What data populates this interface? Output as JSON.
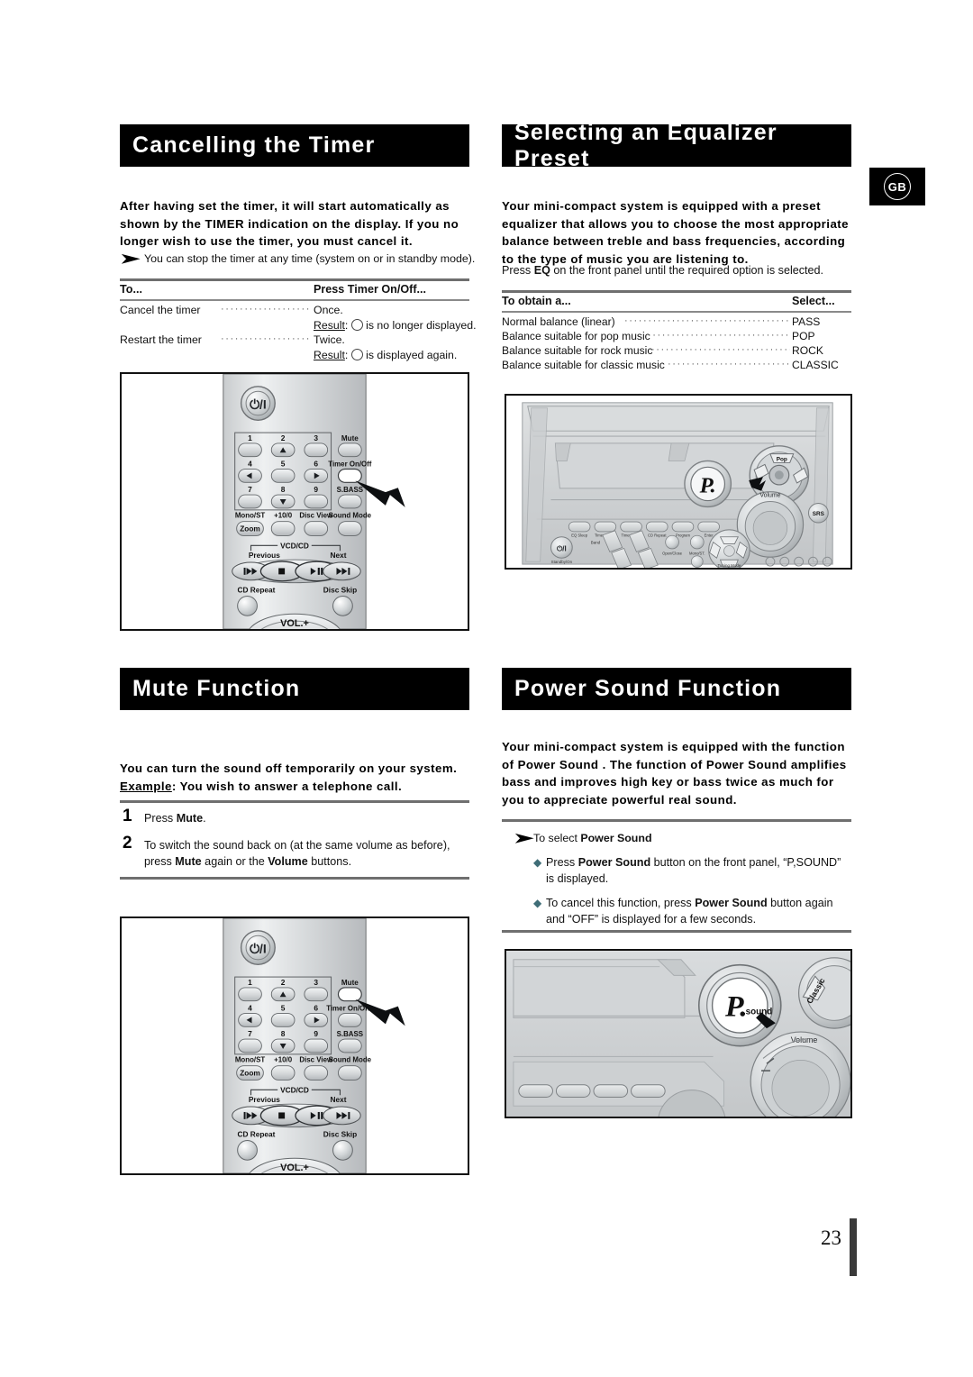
{
  "page": {
    "number": "23",
    "region_badge": "GB"
  },
  "sections": {
    "cancelling_timer": {
      "title": "Cancelling the Timer",
      "intro": "After having set the timer, it will start automatically as shown by the TIMER indication on the display. If you no longer wish to use the timer, you must cancel it.",
      "note": "You can stop the timer at any time (system on or in standby mode).",
      "table": {
        "headers": [
          "To...",
          "Press Timer On/Off..."
        ],
        "rows": [
          {
            "label": "Cancel the timer",
            "value": "Once.",
            "result_prefix": "Result",
            "result_text": "is no longer displayed."
          },
          {
            "label": "Restart the timer",
            "value": "Twice.",
            "result_prefix": "Result",
            "result_text": "is displayed again."
          }
        ]
      },
      "figure": {
        "name": "remote-control-timer-onoff",
        "callout_button": "Timer On/Off"
      }
    },
    "equalizer_preset": {
      "title": "Selecting an Equalizer Preset",
      "intro": "Your mini-compact system is equipped with a preset equalizer that allows you to choose the most appropriate balance between treble and bass frequencies, according to the type of music you are listening to.",
      "instruction_pre": "Press ",
      "instruction_bold": "EQ",
      "instruction_post": " on the front panel until the required option is selected.",
      "table": {
        "headers": [
          "To obtain a...",
          "Select..."
        ],
        "rows": [
          {
            "label": "Normal balance (linear)",
            "value": "PASS"
          },
          {
            "label": "Balance suitable for pop music",
            "value": "POP"
          },
          {
            "label": "Balance suitable for rock music",
            "value": "ROCK"
          },
          {
            "label": "Balance suitable for classic music",
            "value": "CLASSIC"
          }
        ]
      },
      "figure": {
        "name": "front-panel-eq-knob",
        "knob_label": "P.",
        "sbs_label": "SRS",
        "volume_label": "Volume",
        "tuning_label": "Tuning Mode",
        "standby_label": "Standby/On"
      }
    },
    "mute_function": {
      "title": "Mute Function",
      "intro_line1": "You can turn the sound off temporarily on your system.",
      "intro_example_label": "Example",
      "intro_line2": ": You wish to answer a telephone call.",
      "steps": [
        {
          "num": "1",
          "text_pre": "Press ",
          "text_bold": "Mute",
          "text_post": "."
        },
        {
          "num": "2",
          "text": "To switch the sound back on (at the same volume as before), press Mute again or the Volume buttons."
        }
      ],
      "figure": {
        "name": "remote-control-mute",
        "callout_button": "Mute"
      }
    },
    "power_sound": {
      "title": "Power Sound Function",
      "intro": "Your mini-compact system is equipped with the function of Power Sound . The function of Power Sound amplifies bass and improves high key or bass twice as much for you to appreciate powerful real sound.",
      "note_pre": "To select ",
      "note_bold": "Power Sound",
      "bullets": [
        {
          "pre": "Press ",
          "bold": "Power Sound",
          "post": " button on the front panel, “P,SOUND” is displayed."
        },
        {
          "pre": "To cancel this function, press ",
          "bold": "Power Sound",
          "post": " button again and “OFF” is displayed for a few seconds."
        }
      ],
      "figure": {
        "name": "front-panel-power-sound-knob",
        "knob_label": "P.",
        "knob_sub": ".sound",
        "classic_label": "Classic",
        "volume_label": "Volume"
      }
    }
  },
  "remote": {
    "power_symbol": "⏻/I",
    "keys": [
      "1",
      "2",
      "3",
      "4",
      "5",
      "6",
      "7",
      "8",
      "9"
    ],
    "side_labels": [
      "Mute",
      "Timer On/Off",
      "S.BASS",
      "Sound Mode"
    ],
    "row_labels": [
      "Mono/ST",
      "+10/0",
      "Disc View",
      "Sound Mode"
    ],
    "zoom_label": "Zoom",
    "transport_group": "VCD/CD",
    "previous_label": "Previous",
    "next_label": "Next",
    "cd_repeat_label": "CD Repeat",
    "disc_skip_label": "Disc Skip",
    "volume_label": "VOL.+"
  },
  "colors": {
    "header_bg": "#000000",
    "header_text": "#ffffff",
    "rule": "#8a8a8a",
    "bullet": "#3f6d77",
    "body_text": "#111111"
  }
}
